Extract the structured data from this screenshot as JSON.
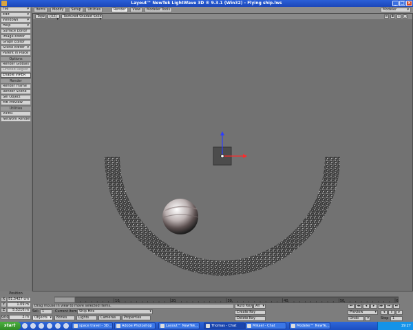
{
  "window": {
    "title": "Layout™ NewTek LightWave 3D ® 9.3.1 (Win32) - Flying ship.lws"
  },
  "left_panel": {
    "items": [
      {
        "label": "File",
        "dropdown": true
      },
      {
        "label": "Edit",
        "dropdown": true
      },
      {
        "label": "Windows",
        "dropdown": true
      },
      {
        "label": "Help",
        "dropdown": true
      },
      {
        "label": "Surface Editor"
      },
      {
        "label": "Image Editor"
      },
      {
        "label": "Graph Editor"
      },
      {
        "label": "Scene Editor",
        "dropdown": true
      },
      {
        "label": "Parent in Place"
      }
    ],
    "options_header": "Options",
    "options_items": [
      {
        "label": "Render Globals"
      },
      {
        "label": "Limited Region",
        "dim": true
      },
      {
        "label": "Enable VIPER",
        "active": true
      }
    ],
    "render_header": "Render",
    "render_items": [
      {
        "label": "Render Frame"
      },
      {
        "label": "Render Scene"
      },
      {
        "label": "Sel Object"
      },
      {
        "label": "MB Preview"
      }
    ],
    "utilities_header": "Utilities",
    "utilities_items": [
      {
        "label": "VIPER"
      },
      {
        "label": "Network Render"
      }
    ]
  },
  "tabs": [
    {
      "label": "Items"
    },
    {
      "label": "Modify"
    },
    {
      "label": "Setup"
    },
    {
      "label": "Utilities"
    },
    {
      "label": "Render",
      "active": true
    },
    {
      "label": "View"
    },
    {
      "label": "Modeler Tools"
    }
  ],
  "modeler_dropdown": "Modeler",
  "viewport": {
    "view_select": "Top",
    "axis_select": "(XZ)",
    "shading_select": "Textured Shaded Solid"
  },
  "position_panel": {
    "label": "Position",
    "x_axis": "X",
    "x_value": "81.5427 cm",
    "y_axis": "Y",
    "y_value": "1.09 m",
    "z_axis": "Z",
    "z_value": "5.5216 m",
    "grid_label": "Grid",
    "grid_value": "2 m"
  },
  "timeline": {
    "ticks": [
      "0",
      "10",
      "20",
      "30",
      "40",
      "50",
      "60"
    ],
    "current_frame": "0",
    "end_frame": "60"
  },
  "status_message": "Drag mouse in view to move selected items.",
  "current_item": {
    "sel_label": "Sel:",
    "sel_value": "1",
    "label": "Current Item",
    "value": "Ship Hits"
  },
  "item_type_buttons": {
    "objects": "Objects",
    "bones": "Bones",
    "lights": "Lights",
    "cameras": "Cameras",
    "properties": "Properties"
  },
  "keys": {
    "auto_key": "Auto Key",
    "auto_key_value": "All",
    "create_key": "Create Key",
    "delete_key": "Delete Key"
  },
  "playback": {
    "preview": "Preview",
    "undo": "Undo",
    "step_label": "Step",
    "step_value": "1"
  },
  "taskbar": {
    "start": "start",
    "items": [
      {
        "label": "space travel - 3D..."
      },
      {
        "label": "Adobe Photoshop"
      },
      {
        "label": "Layout™ NewTek..."
      },
      {
        "label": "Thomas - Chat",
        "active": true
      },
      {
        "label": "Mikael - Chat"
      },
      {
        "label": "Modeler™ NewTe..."
      }
    ],
    "clock": "19:27"
  }
}
